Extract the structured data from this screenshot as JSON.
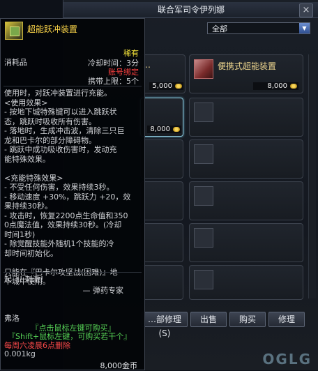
{
  "shop": {
    "title": "联合军司令伊列娜",
    "close_label": "×",
    "category": {
      "selected": "全部"
    },
    "items": [
      {
        "name": "…",
        "price": "5,000",
        "currency_icon": "gold-coin-icon"
      },
      {
        "name": "便携式超能装置",
        "price": "8,000",
        "currency_icon": "gold-coin-icon"
      },
      {
        "name": "",
        "price": "8,000",
        "currency_icon": "gold-coin-icon"
      }
    ],
    "buttons": {
      "repair_all": "…部修理 (S)",
      "sell": "出售",
      "buy": "购买",
      "repair": "修理"
    },
    "watermark": "OGLG"
  },
  "tooltip": {
    "name": "超能跃冲装置",
    "type": "消耗品",
    "rarity": "稀有",
    "cooldown": "冷却时间：3分",
    "binding": "账号绑定",
    "stack_limit": "携带上限：5个",
    "description": "使用时，对跃冲装置进行充能。\n<使用效果>\n- 按地下城特殊键可以进入跳跃状\n态，跳跃时吸收所有伤害。\n- 落地时，生成冲击波，清除三只巨\n龙和巴卡尔的部分障碍物。\n- 跳跃中成功吸收伤害时，发动充\n能特殊效果。\n\n<充能特殊效果>\n- 不受任何伤害，效果持续3秒。\n- 移动速度 +30%，跳跃力 +20，效\n果持续30秒。\n- 攻击时，恢复2200点生命值和350\n0点魔法值，效果持续30秒。(冷却\n时间1秒)\n- 除觉醒技能外随机1个技能的冷\n却时间初始化。\n\n只能在『巴卡尔攻坚战(困难)』地\n下城中使用。",
    "flavor_line1": "起飞! 刺激!",
    "flavor_author": "— 弹药专家",
    "flavor_line2": "弗洛",
    "click_buy": "『点击鼠标左键可购买』",
    "shift_buy": "『Shift+鼠标左键，可购买若干个』",
    "delete_note": "每周六凌晨6点删除",
    "weight": "0.001kg",
    "price": "8,000金币"
  },
  "colors": {
    "item_name": "#ffd84a",
    "rarity": "#f4e33a",
    "binding": "#ff4040",
    "hint": "#57d456",
    "delete_note": "#ff4a4a"
  }
}
